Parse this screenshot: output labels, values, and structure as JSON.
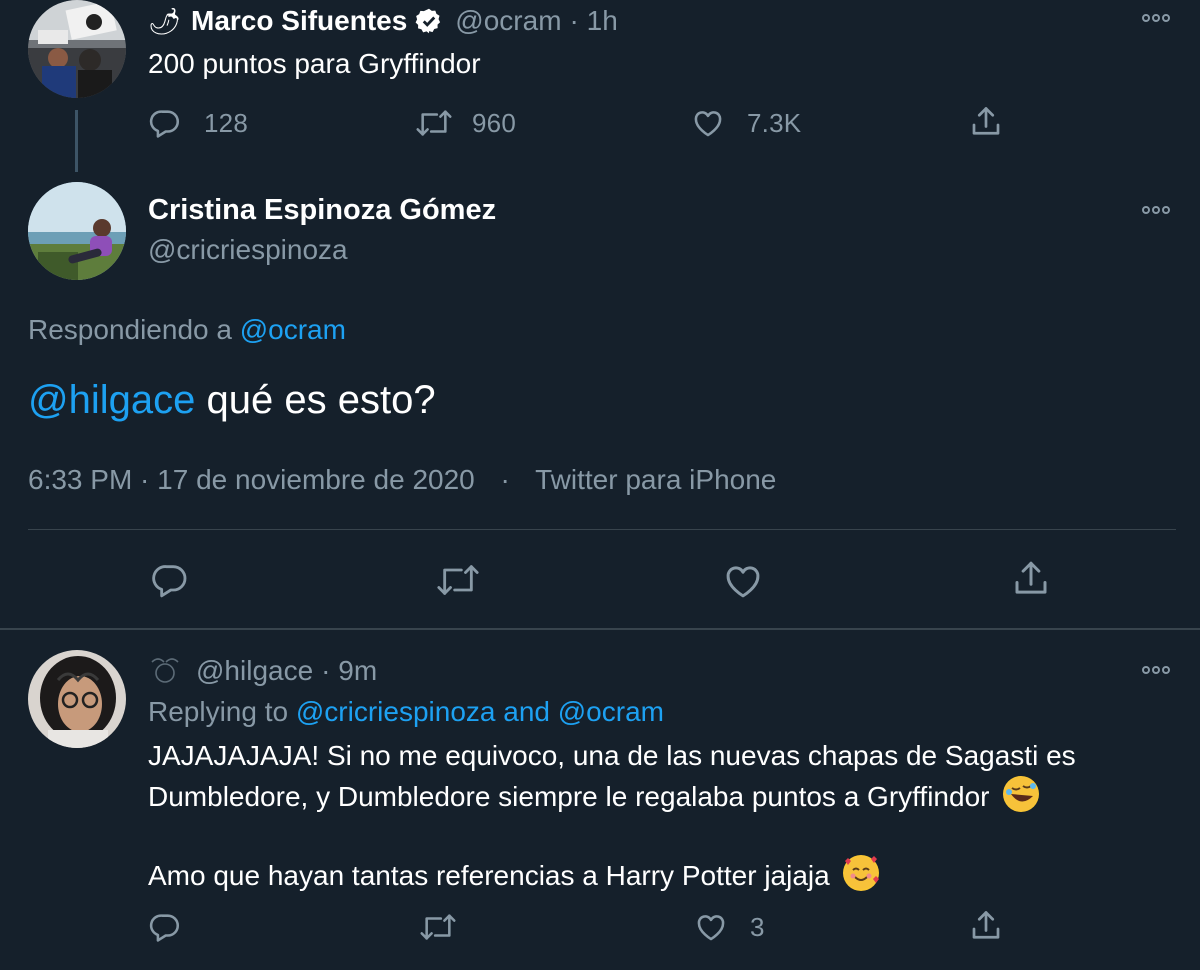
{
  "tweet1": {
    "name_emoji": "🌶",
    "display_name": "Marco Sifuentes",
    "handle": "@ocram",
    "time": "· 1h",
    "text": "200 puntos para Gryffindor",
    "replies": "128",
    "retweets": "960",
    "likes": "7.3K",
    "more_icon": "more-horizontal-icon"
  },
  "tweet2": {
    "display_name": "Cristina Espinoza Gómez",
    "handle": "@cricriespinoza",
    "replying_prefix": "Respondiendo a",
    "replying_handle": "@ocram",
    "mention": "@hilgace",
    "text": "qué es esto?",
    "timestamp": "6:33 PM · 17 de noviembre de 2020",
    "separator": "·",
    "source": "Twitter para iPhone"
  },
  "tweet3": {
    "handle": "@hilgace",
    "time": "· 9m",
    "replying_prefix": "Replying to",
    "replying_handles": "@cricriespinoza and @ocram",
    "line1": "JAJAJAJAJA! Si no me equivoco, una de las nuevas chapas de Sagasti es",
    "line2": "Dumbledore, y Dumbledore siempre le regalaba puntos a Gryffindor",
    "line3": "Amo que hayan tantas referencias a Harry Potter jajaja",
    "likes": "3",
    "emoji1": "🤣",
    "emoji2": "🥰"
  },
  "colors": {
    "background": "#15202b",
    "muted": "#8899a6",
    "link": "#1da1f2",
    "divider": "#38444d"
  }
}
